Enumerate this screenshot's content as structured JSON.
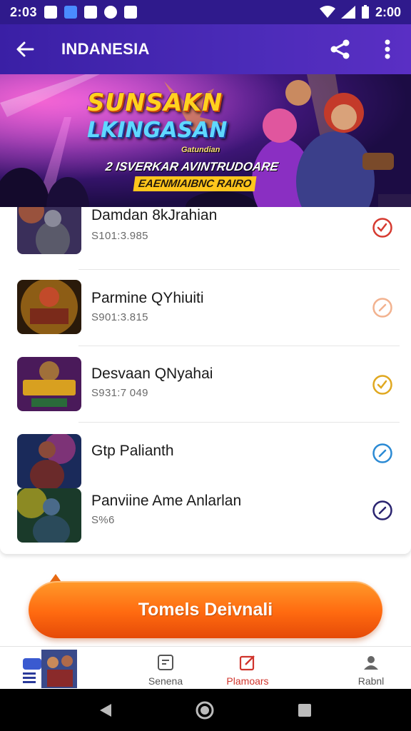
{
  "status_bar": {
    "time": "2:03",
    "clock": "2:00",
    "icons": [
      "notification-icon",
      "app-icon",
      "music-icon",
      "photo-icon",
      "wifi-icon",
      "signal-icon",
      "battery-icon"
    ]
  },
  "app_bar": {
    "title": "INDANESIA",
    "back_icon": "arrow-left-icon",
    "share_icon": "share-icon",
    "menu_icon": "more-vert-icon"
  },
  "banner": {
    "title_line1": "SUNSAKN",
    "title_line2": "LKINGASAN",
    "tag": "Gatundian",
    "subtitle_line1": "2 ISVERKAR AVINTRUDOARE",
    "subtitle_line2": "EAENMIAIBNC RAIRO"
  },
  "items": [
    {
      "name": "Damdan 8kJrahian",
      "meta": "S101:3.985",
      "status_color": "#d63a30"
    },
    {
      "name": "Parmine QYhiuiti",
      "meta": "S901:3.815",
      "status_color": "#f2b28f"
    },
    {
      "name": "Desvaan QNyahai",
      "meta": "S931:7 049",
      "status_color": "#e0a820"
    },
    {
      "name": "Gtp Palianth",
      "meta": "",
      "status_color": "#2b8ad4"
    },
    {
      "name": "Panviine Ame Anlarlan",
      "meta": "S%6",
      "status_color": "#2a2470"
    }
  ],
  "cta": {
    "label": "Tomels Deivnali"
  },
  "bottom_nav": [
    {
      "label": "",
      "icon": "chat-icon"
    },
    {
      "label": "Senena",
      "icon": "screen-icon"
    },
    {
      "label": "Plamoars",
      "icon": "edit-icon",
      "active": true
    },
    {
      "label": "Rabnl",
      "icon": "person-icon"
    }
  ],
  "colors": {
    "app_bar": "#3a1fa5",
    "accent_orange": "#ff6a10",
    "active_nav": "#d0342c"
  }
}
